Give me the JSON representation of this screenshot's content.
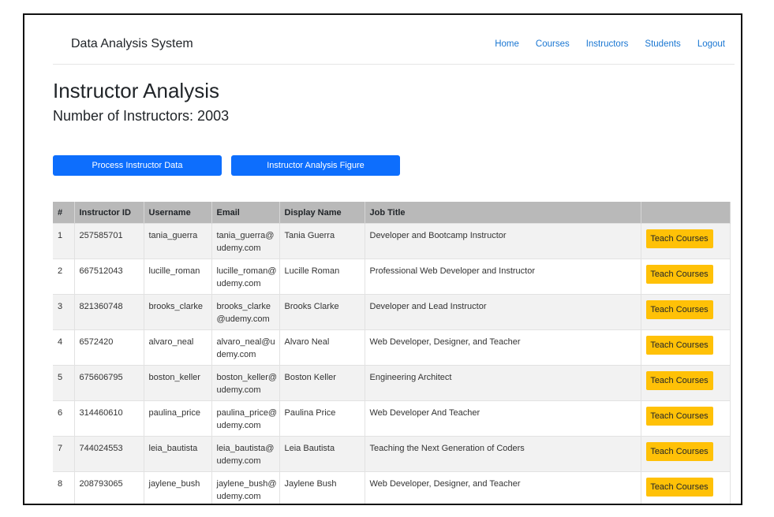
{
  "nav": {
    "brand": "Data Analysis System",
    "links": [
      "Home",
      "Courses",
      "Instructors",
      "Students",
      "Logout"
    ]
  },
  "page": {
    "title": "Instructor Analysis",
    "count_text": "Number of Instructors: 2003"
  },
  "buttons": {
    "process": "Process Instructor Data",
    "figure": "Instructor Analysis Figure"
  },
  "table": {
    "headers": [
      "#",
      "Instructor ID",
      "Username",
      "Email",
      "Display Name",
      "Job Title",
      ""
    ],
    "action_label": "Teach Courses",
    "rows": [
      {
        "num": "1",
        "id": "257585701",
        "username": "tania_guerra",
        "email1": "tania_guerra@",
        "email2": "udemy.com",
        "name": "Tania Guerra",
        "job": "Developer and Bootcamp Instructor"
      },
      {
        "num": "2",
        "id": "667512043",
        "username": "lucille_roman",
        "email1": "lucille_roman@",
        "email2": "udemy.com",
        "name": "Lucille Roman",
        "job": "Professional Web Developer and Instructor"
      },
      {
        "num": "3",
        "id": "821360748",
        "username": "brooks_clarke",
        "email1": "brooks_clarke",
        "email2": "@udemy.com",
        "name": "Brooks Clarke",
        "job": "Developer and Lead Instructor"
      },
      {
        "num": "4",
        "id": "6572420",
        "username": "alvaro_neal",
        "email1": "alvaro_neal@u",
        "email2": "demy.com",
        "name": "Alvaro Neal",
        "job": "Web Developer, Designer, and Teacher"
      },
      {
        "num": "5",
        "id": "675606795",
        "username": "boston_keller",
        "email1": "boston_keller@",
        "email2": "udemy.com",
        "name": "Boston Keller",
        "job": "Engineering Architect"
      },
      {
        "num": "6",
        "id": "314460610",
        "username": "paulina_price",
        "email1": "paulina_price@",
        "email2": "udemy.com",
        "name": "Paulina Price",
        "job": "Web Developer And Teacher"
      },
      {
        "num": "7",
        "id": "744024553",
        "username": "leia_bautista",
        "email1": "leia_bautista@",
        "email2": "udemy.com",
        "name": "Leia Bautista",
        "job": "Teaching the Next Generation of Coders"
      },
      {
        "num": "8",
        "id": "208793065",
        "username": "jaylene_bush",
        "email1": "jaylene_bush@",
        "email2": "udemy.com",
        "name": "Jaylene Bush",
        "job": "Web Developer, Designer, and Teacher"
      }
    ]
  }
}
